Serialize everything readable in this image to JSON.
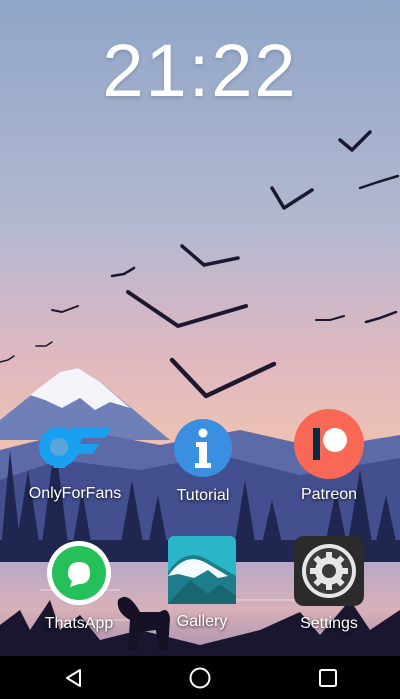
{
  "clock": {
    "time": "21:22"
  },
  "apps": [
    {
      "label": "OnlyForFans",
      "icon": "off-logo-icon",
      "color": "#1aa0f0"
    },
    {
      "label": "Tutorial",
      "icon": "info-icon",
      "color": "#3b8fe0"
    },
    {
      "label": "Patreon",
      "icon": "patreon-icon",
      "color": "#f96854"
    },
    {
      "label": "ThatsApp",
      "icon": "chat-bubble-icon",
      "color": "#25c05a"
    },
    {
      "label": "Gallery",
      "icon": "gallery-mountain-icon",
      "color": "#2bb5c8"
    },
    {
      "label": "Settings",
      "icon": "gear-icon",
      "color": "#333333"
    }
  ],
  "navbar": {
    "back_icon": "back-triangle-icon",
    "home_icon": "home-circle-icon",
    "recents_icon": "recents-square-icon"
  }
}
